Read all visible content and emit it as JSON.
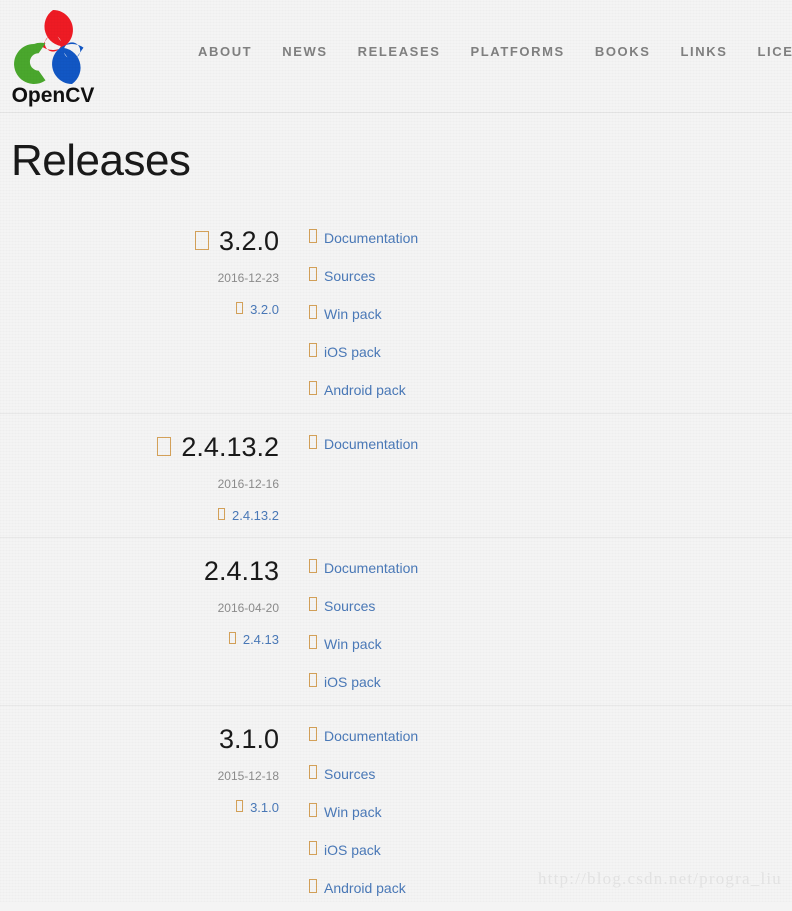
{
  "site": {
    "logo_text": "OpenCV",
    "logo_colors": {
      "top": "#ee1b24",
      "left": "#4aa72d",
      "right": "#1257c4",
      "text": "#111111"
    }
  },
  "nav": {
    "items": [
      {
        "label": "ABOUT",
        "name": "nav-item-about"
      },
      {
        "label": "NEWS",
        "name": "nav-item-news"
      },
      {
        "label": "RELEASES",
        "name": "nav-item-releases"
      },
      {
        "label": "PLATFORMS",
        "name": "nav-item-platforms"
      },
      {
        "label": "BOOKS",
        "name": "nav-item-books"
      },
      {
        "label": "LINKS",
        "name": "nav-item-links"
      },
      {
        "label": "LICENSE",
        "name": "nav-item-license"
      }
    ]
  },
  "page": {
    "title": "Releases"
  },
  "theme": {
    "background": "#f4f4f4",
    "link": "#4a79b8",
    "icon_box": "#d4a159",
    "nav_text": "#808080",
    "date_text": "#8c8c8c",
    "separator": "#e8e8e8"
  },
  "releases": [
    {
      "version": "3.2.0",
      "date": "2016-12-23",
      "tag": "3.2.0",
      "has_version_icon": true,
      "downloads": [
        {
          "label": "Documentation"
        },
        {
          "label": "Sources"
        },
        {
          "label": "Win pack"
        },
        {
          "label": "iOS pack"
        },
        {
          "label": "Android pack"
        }
      ]
    },
    {
      "version": "2.4.13.2",
      "date": "2016-12-16",
      "tag": "2.4.13.2",
      "has_version_icon": true,
      "downloads": [
        {
          "label": "Documentation"
        }
      ]
    },
    {
      "version": "2.4.13",
      "date": "2016-04-20",
      "tag": "2.4.13",
      "has_version_icon": false,
      "downloads": [
        {
          "label": "Documentation"
        },
        {
          "label": "Sources"
        },
        {
          "label": "Win pack"
        },
        {
          "label": "iOS pack"
        }
      ]
    },
    {
      "version": "3.1.0",
      "date": "2015-12-18",
      "tag": "3.1.0",
      "has_version_icon": false,
      "downloads": [
        {
          "label": "Documentation"
        },
        {
          "label": "Sources"
        },
        {
          "label": "Win pack"
        },
        {
          "label": "iOS pack"
        },
        {
          "label": "Android pack"
        }
      ]
    }
  ],
  "watermark": {
    "text": "http://blog.csdn.net/progra_liu"
  }
}
